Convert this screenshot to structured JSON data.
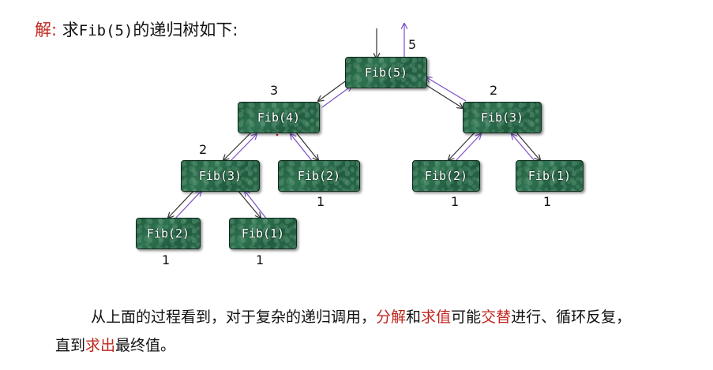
{
  "title": {
    "prefix": "解:",
    "text_before": "求",
    "fib_expr": "Fib(5)",
    "text_after": "的递归树如下:"
  },
  "nodes": [
    {
      "id": "n5",
      "label": "Fib(5)"
    },
    {
      "id": "n4",
      "label": "Fib(4)"
    },
    {
      "id": "n3r",
      "label": "Fib(3)"
    },
    {
      "id": "n3l",
      "label": "Fib(3)"
    },
    {
      "id": "n2a",
      "label": "Fib(2)"
    },
    {
      "id": "n2b",
      "label": "Fib(2)"
    },
    {
      "id": "n1a",
      "label": "Fib(1)"
    },
    {
      "id": "n2c",
      "label": "Fib(2)"
    },
    {
      "id": "n1b",
      "label": "Fib(1)"
    }
  ],
  "values": {
    "n5": "5",
    "n4": "3",
    "n3r": "2",
    "n3l": "2",
    "n2a": "1",
    "n2b": "1",
    "n1a": "1",
    "n2c": "1",
    "n1b": "1"
  },
  "paragraph": {
    "line1_a": "从上面的过程看到，对于复杂的递归调用，",
    "line1_red1": "分解",
    "line1_b": "和",
    "line1_red2": "求值",
    "line1_c": "可能",
    "line1_red3": "交替",
    "line1_d": "进行、循环反复，",
    "line2_a": "直到",
    "line2_red": "求出",
    "line2_b": "最终值。"
  },
  "colors": {
    "accent_red": "#c0271f",
    "node_green": "#2f7452",
    "arrow_purple": "#7b4fc6",
    "arrow_dark": "#333333"
  }
}
